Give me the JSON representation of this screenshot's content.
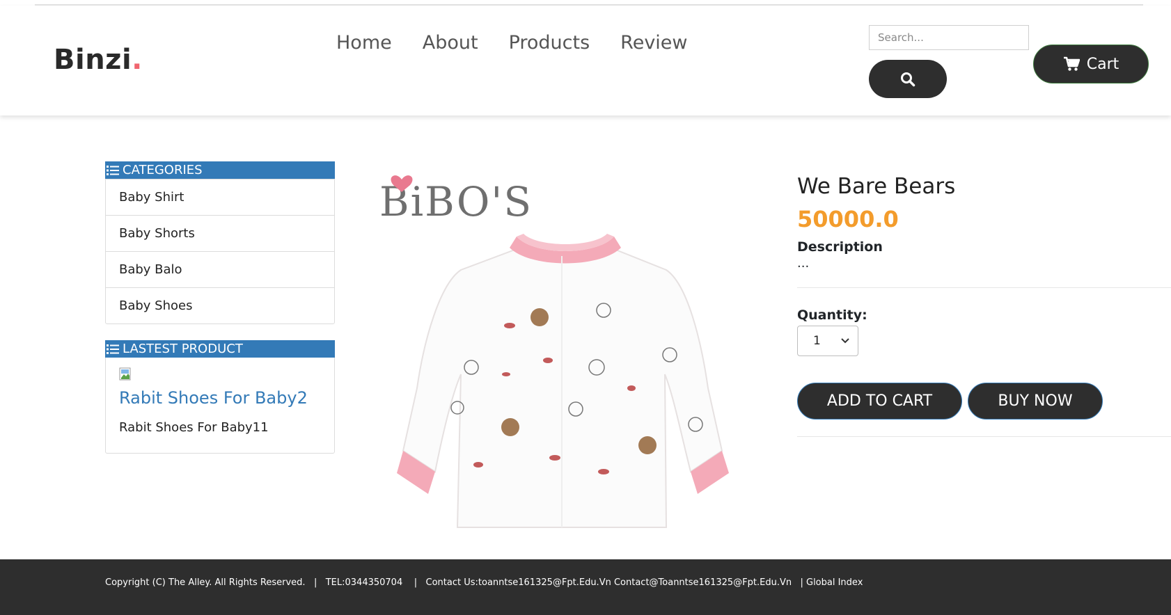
{
  "brand": {
    "name": "Binzi",
    "dot": "."
  },
  "nav": {
    "items": [
      "Home",
      "About",
      "Products",
      "Review"
    ]
  },
  "search": {
    "placeholder": "Search..."
  },
  "cart": {
    "label": "Cart"
  },
  "sidebar": {
    "categories_title": "CATEGORIES",
    "categories": [
      "Baby Shirt",
      "Baby Shorts",
      "Baby Balo",
      "Baby Shoes"
    ],
    "latest_title": "LASTEST PRODUCT",
    "latest_link": "Rabit Shoes For Baby2",
    "latest_text": "Rabit Shoes For Baby11"
  },
  "product": {
    "brand_mark": "BiBO'S",
    "name": "We Bare Bears",
    "price": "50000.0",
    "description_label": "Description",
    "description": "...",
    "quantity_label": "Quantity:",
    "quantity": "1",
    "add_to_cart": "ADD TO CART",
    "buy_now": "BUY NOW"
  },
  "footer": {
    "text": "Copyright (C) The Alley. All Rights Reserved.   |   TEL:0344350704    |   Contact Us:toanntse161325@Fpt.Edu.Vn Contact@Toanntse161325@Fpt.Edu.Vn   | Global Index"
  },
  "colors": {
    "accent": "#337ab7",
    "price": "#f39c2c",
    "dark": "#2e2e2e",
    "logo_dot": "#f0656f"
  }
}
